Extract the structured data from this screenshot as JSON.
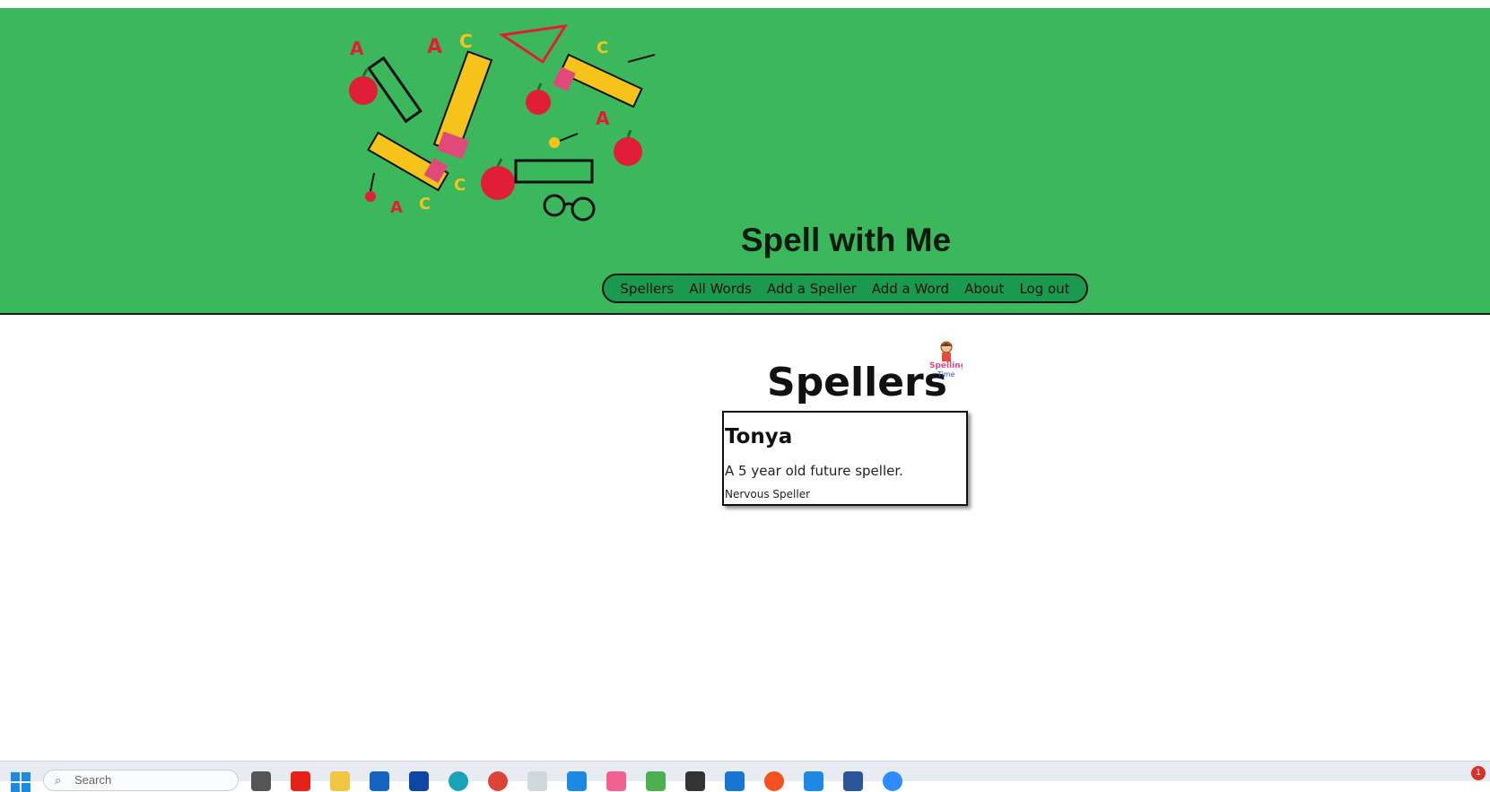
{
  "site": {
    "title": "Spell with Me"
  },
  "nav": {
    "items": [
      "Spellers",
      "All Words",
      "Add a Speller",
      "Add a Word",
      "About",
      "Log out"
    ]
  },
  "page": {
    "heading": "Spellers",
    "logo_text_line1": "Spelling",
    "logo_text_line2": "Time"
  },
  "spellers": [
    {
      "name": "Tonya",
      "description": "A 5 year old future speller.",
      "status": "Nervous Speller"
    }
  ],
  "taskbar": {
    "search_placeholder": "Search",
    "notification_count": "1"
  },
  "colors": {
    "header_bg": "#3cb85c",
    "nav_bg": "#1a9a4f",
    "text": "#111111"
  }
}
